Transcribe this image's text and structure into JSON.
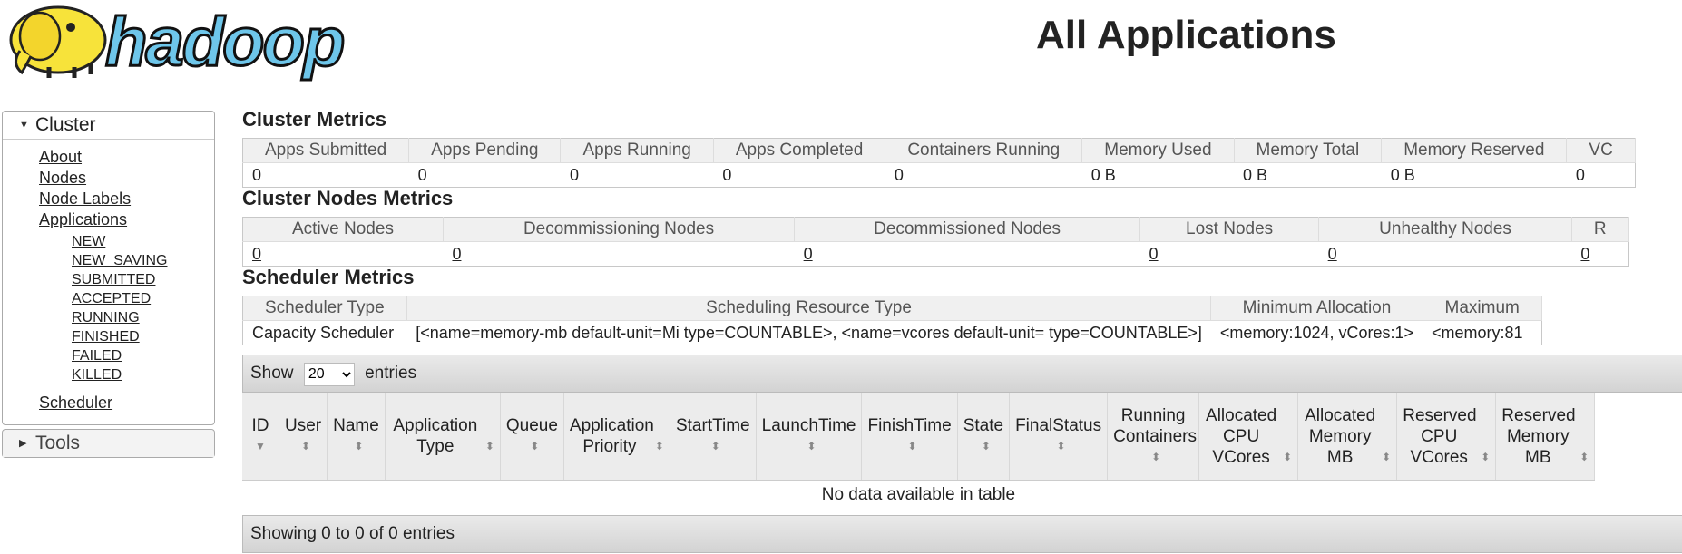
{
  "header": {
    "title": "All Applications",
    "logo_text": "hadoop"
  },
  "sidebar": {
    "cluster_label": "Cluster",
    "links": [
      "About",
      "Nodes",
      "Node Labels",
      "Applications"
    ],
    "app_states": [
      "NEW",
      "NEW_SAVING",
      "SUBMITTED",
      "ACCEPTED",
      "RUNNING",
      "FINISHED",
      "FAILED",
      "KILLED"
    ],
    "scheduler_label": "Scheduler",
    "tools_label": "Tools"
  },
  "cluster_metrics": {
    "title": "Cluster Metrics",
    "headers": [
      "Apps Submitted",
      "Apps Pending",
      "Apps Running",
      "Apps Completed",
      "Containers Running",
      "Memory Used",
      "Memory Total",
      "Memory Reserved",
      "VC"
    ],
    "values": [
      "0",
      "0",
      "0",
      "0",
      "0",
      "0 B",
      "0 B",
      "0 B",
      "0"
    ]
  },
  "nodes_metrics": {
    "title": "Cluster Nodes Metrics",
    "headers": [
      "Active Nodes",
      "Decommissioning Nodes",
      "Decommissioned Nodes",
      "Lost Nodes",
      "Unhealthy Nodes",
      "R"
    ],
    "values": [
      "0",
      "0",
      "0",
      "0",
      "0",
      "0"
    ]
  },
  "scheduler_metrics": {
    "title": "Scheduler Metrics",
    "headers": [
      "Scheduler Type",
      "Scheduling Resource Type",
      "Minimum Allocation",
      "Maximum"
    ],
    "values": [
      "Capacity Scheduler",
      "[<name=memory-mb default-unit=Mi type=COUNTABLE>, <name=vcores default-unit= type=COUNTABLE>]",
      "<memory:1024, vCores:1>",
      "<memory:81"
    ]
  },
  "apps_table": {
    "show_label": "Show",
    "entries_label": "entries",
    "page_size": "20",
    "columns": [
      "ID",
      "User",
      "Name",
      "Application Type",
      "Queue",
      "Application Priority",
      "StartTime",
      "LaunchTime",
      "FinishTime",
      "State",
      "FinalStatus",
      "Running Containers",
      "Allocated CPU VCores",
      "Allocated Memory MB",
      "Reserved CPU VCores",
      "Reserved Memory MB"
    ],
    "empty_message": "No data available in table",
    "footer": "Showing 0 to 0 of 0 entries"
  },
  "colors": {
    "logo_blue": "#6ec6ea",
    "elephant_yellow": "#f7e33a",
    "header_bg": "#f0f0f0"
  }
}
